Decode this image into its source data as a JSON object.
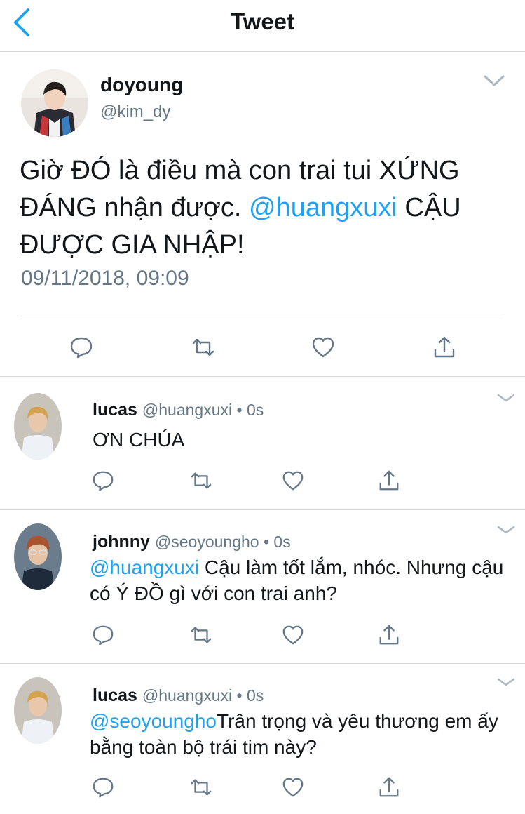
{
  "nav": {
    "title": "Tweet"
  },
  "main_tweet": {
    "name": "doyoung",
    "handle": "@kim_dy",
    "text_part1": "Giờ ĐÓ là điều mà con trai tui XỨNG ĐÁNG nhận được. ",
    "mention": "@huangxuxi",
    "text_part2": " CẬU ĐƯỢC GIA NHẬP!",
    "timestamp": "09/11/2018, 09:09"
  },
  "replies": [
    {
      "name": "lucas",
      "handle": "@huangxuxi",
      "time": "0s",
      "mention": "",
      "text": "ƠN CHÚA"
    },
    {
      "name": "johnny",
      "handle": "@seoyoungho",
      "time": "0s",
      "mention": "@huangxuxi",
      "text": " Cậu làm tốt lắm, nhóc.  Nhưng cậu có Ý ĐỒ gì với con trai anh?"
    },
    {
      "name": "lucas",
      "handle": "@huangxuxi",
      "time": "0s",
      "mention": "@seoyoungho",
      "text": "Trân trọng và yêu thương em ấy bằng toàn bộ trái tim này?"
    }
  ],
  "separator": " • ",
  "icons": [
    "back-icon",
    "chevron-down-icon",
    "reply-icon",
    "retweet-icon",
    "like-icon",
    "share-icon"
  ],
  "colors": {
    "link": "#1da1f2",
    "secondary": "#657786",
    "icon": "#657786",
    "border": "#d6d9dc"
  }
}
